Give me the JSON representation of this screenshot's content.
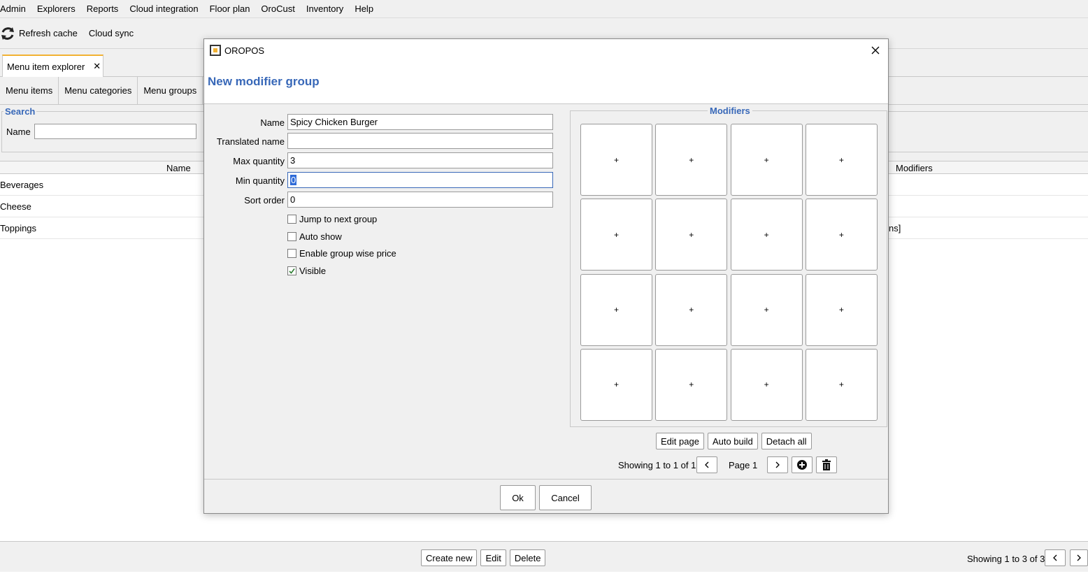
{
  "menubar": [
    "Admin",
    "Explorers",
    "Reports",
    "Cloud integration",
    "Floor plan",
    "OroCust",
    "Inventory",
    "Help"
  ],
  "toolbar": {
    "refresh_label": "Refresh cache",
    "cloud_sync_label": "Cloud sync"
  },
  "tab": {
    "label": "Menu item explorer",
    "close": "✕"
  },
  "subtabs": [
    "Menu items",
    "Menu categories",
    "Menu groups"
  ],
  "search": {
    "legend": "Search",
    "name_label": "Name",
    "name_value": ""
  },
  "table": {
    "headers": {
      "name": "Name",
      "modifiers": "Modifiers"
    },
    "rows": [
      {
        "name": "Beverages",
        "modifiers": ""
      },
      {
        "name": "Cheese",
        "modifiers": ""
      },
      {
        "name": "Toppings",
        "modifiers": "ns]"
      }
    ]
  },
  "bottom": {
    "create_label": "Create new",
    "edit_label": "Edit",
    "delete_label": "Delete",
    "showing": "Showing 1 to 3 of 3"
  },
  "dialog": {
    "title": "OROPOS",
    "heading": "New modifier group",
    "fields": {
      "name_label": "Name",
      "name_value": "Spicy Chicken Burger",
      "translated_label": "Translated name",
      "translated_value": "",
      "max_label": "Max quantity",
      "max_value": "3",
      "min_label": "Min quantity",
      "min_value": "0",
      "sort_label": "Sort order",
      "sort_value": "0"
    },
    "checkboxes": [
      {
        "label": "Jump to next group",
        "checked": false
      },
      {
        "label": "Auto show",
        "checked": false
      },
      {
        "label": "Enable group wise price",
        "checked": false
      },
      {
        "label": "Visible",
        "checked": true
      }
    ],
    "modifiers_legend": "Modifiers",
    "modifier_cell_symbol": "+",
    "modifier_cell_count": 16,
    "edit_page_label": "Edit page",
    "auto_build_label": "Auto build",
    "detach_all_label": "Detach all",
    "pager_text": "Showing 1 to 1 of 1",
    "page_label": "Page 1",
    "ok_label": "Ok",
    "cancel_label": "Cancel"
  },
  "colors": {
    "accent_blue": "#3868b8",
    "tab_highlight": "#f2b233",
    "selection": "#2f6bd8"
  }
}
